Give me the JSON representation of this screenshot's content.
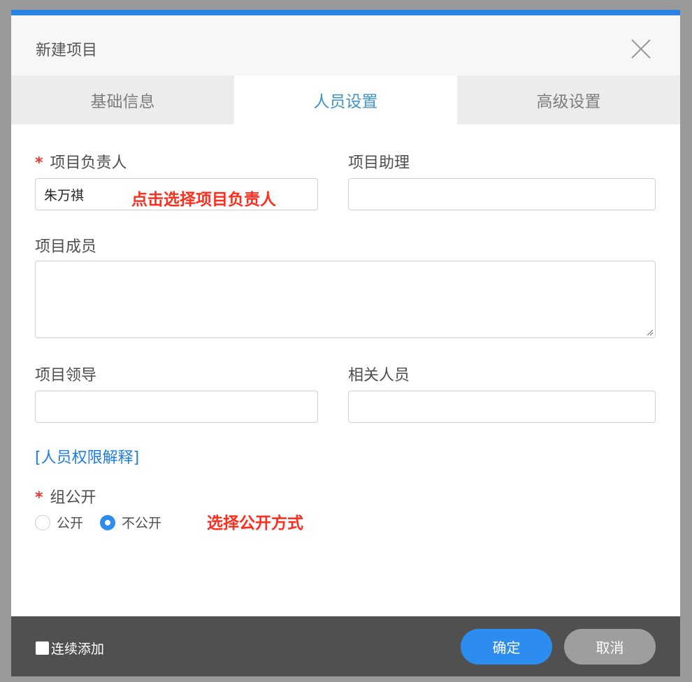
{
  "dialog": {
    "title": "新建项目",
    "close_icon": "close-icon"
  },
  "tabs": [
    {
      "label": "基础信息",
      "active": false
    },
    {
      "label": "人员设置",
      "active": true
    },
    {
      "label": "高级设置",
      "active": false
    }
  ],
  "form": {
    "required_mark": "*",
    "leader": {
      "label": "项目负责人",
      "value": "朱万祺"
    },
    "assistant": {
      "label": "项目助理",
      "value": ""
    },
    "members": {
      "label": "项目成员",
      "value": ""
    },
    "supervisor": {
      "label": "项目领导",
      "value": ""
    },
    "related": {
      "label": "相关人员",
      "value": ""
    },
    "permission_link": "[人员权限解释]",
    "group_public": {
      "label": "组公开",
      "options": [
        {
          "label": "公开",
          "checked": false
        },
        {
          "label": "不公开",
          "checked": true
        }
      ]
    }
  },
  "annotations": {
    "leader_hint": "点击选择项目负责人",
    "public_hint": "选择公开方式"
  },
  "footer": {
    "continue_label": "连续添加",
    "continue_checked": false,
    "ok_label": "确定",
    "cancel_label": "取消"
  },
  "colors": {
    "accent": "#2a82e4",
    "primary_button": "#2d8cf0",
    "annotation": "#ff2d1e",
    "active_tab": "#3f94c5",
    "footer_bg": "#505050"
  }
}
